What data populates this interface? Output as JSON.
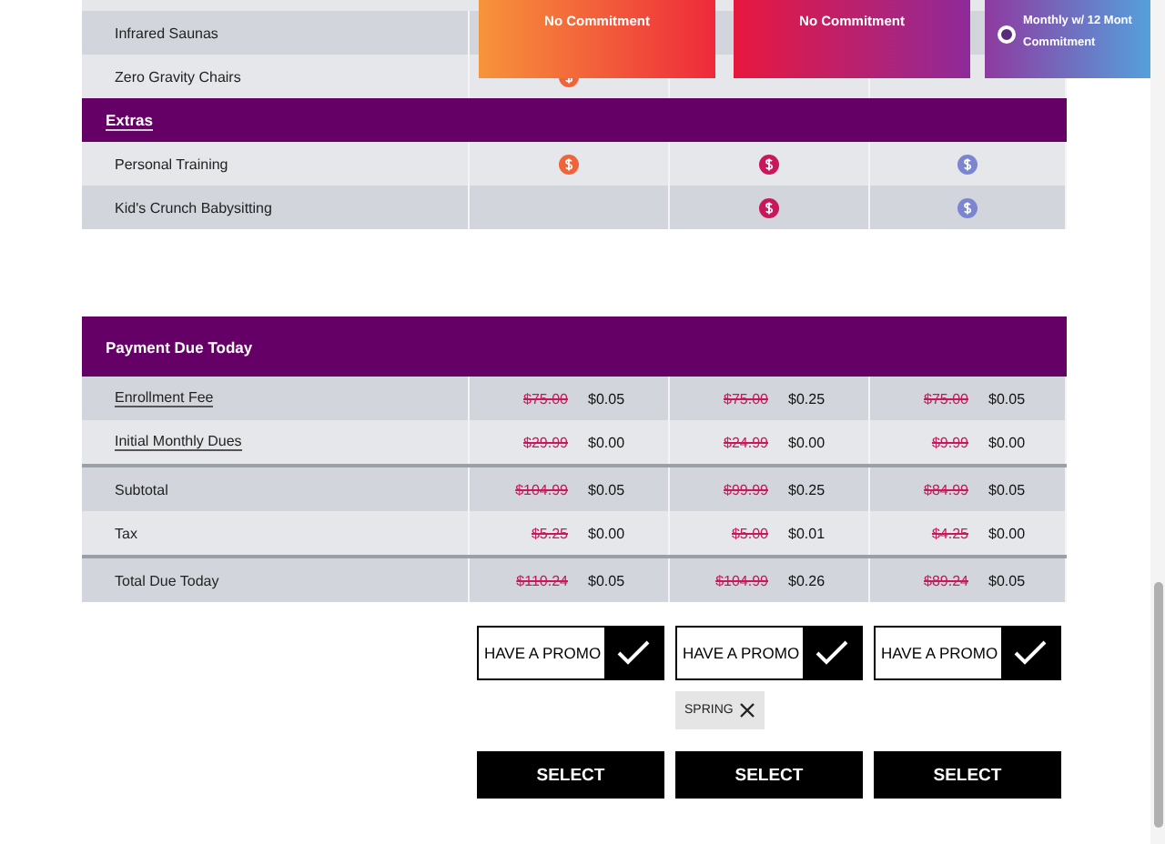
{
  "plans": [
    {
      "kind": "plain",
      "lines": [
        "No Commitment"
      ]
    },
    {
      "kind": "plain",
      "lines": [
        "No Commitment"
      ]
    },
    {
      "kind": "radio",
      "selected": false,
      "lines": [
        "Monthly w/ 12 Mont",
        "Commitment"
      ]
    }
  ],
  "amenities": {
    "rows": [
      {
        "label": "Infrared Saunas",
        "included": [
          false,
          false,
          false
        ]
      },
      {
        "label": "Zero Gravity Chairs",
        "included": [
          true,
          false,
          false
        ]
      }
    ]
  },
  "extras": {
    "title": "Extras",
    "rows": [
      {
        "label": "Personal Training",
        "included": [
          true,
          true,
          true
        ]
      },
      {
        "label": "Kid's Crunch Babysitting",
        "included": [
          false,
          true,
          true
        ]
      }
    ]
  },
  "payment": {
    "title": "Payment Due Today",
    "rows": [
      {
        "label": "Enrollment Fee",
        "kind": "link",
        "divider_above": false,
        "cells": [
          {
            "old": "$75.00",
            "new": "$0.05"
          },
          {
            "old": "$75.00",
            "new": "$0.25"
          },
          {
            "old": "$75.00",
            "new": "$0.05"
          }
        ]
      },
      {
        "label": "Initial Monthly Dues",
        "kind": "link",
        "divider_above": false,
        "cells": [
          {
            "old": "$29.99",
            "new": "$0.00"
          },
          {
            "old": "$24.99",
            "new": "$0.00"
          },
          {
            "old": "$9.99",
            "new": "$0.00"
          }
        ]
      },
      {
        "label": "Subtotal",
        "kind": "plain",
        "divider_above": true,
        "cells": [
          {
            "old": "$104.99",
            "new": "$0.05"
          },
          {
            "old": "$99.99",
            "new": "$0.25"
          },
          {
            "old": "$84.99",
            "new": "$0.05"
          }
        ]
      },
      {
        "label": "Tax",
        "kind": "plain",
        "divider_above": false,
        "cells": [
          {
            "old": "$5.25",
            "new": "$0.00"
          },
          {
            "old": "$5.00",
            "new": "$0.01"
          },
          {
            "old": "$4.25",
            "new": "$0.00"
          }
        ]
      },
      {
        "label": "Total Due Today",
        "kind": "plain",
        "divider_above": true,
        "cells": [
          {
            "old": "$110.24",
            "new": "$0.05"
          },
          {
            "old": "$104.99",
            "new": "$0.26"
          },
          {
            "old": "$89.24",
            "new": "$0.05"
          }
        ]
      }
    ]
  },
  "promos": [
    {
      "label": "HAVE A PROMO"
    },
    {
      "label": "HAVE A PROMO",
      "code": "SPRING"
    },
    {
      "label": "HAVE A PROMO"
    }
  ],
  "select_buttons": [
    "SELECT",
    "SELECT",
    "SELECT"
  ]
}
